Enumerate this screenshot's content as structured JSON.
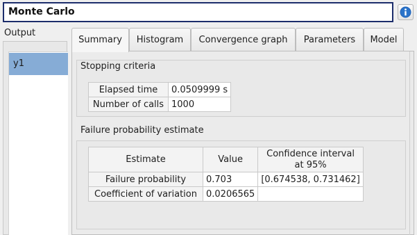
{
  "header": {
    "title": "Monte Carlo",
    "info_icon": "info-icon",
    "info_color": "#1f63b8"
  },
  "sidebar": {
    "label": "Output",
    "items": [
      {
        "label": "y1",
        "selected": true
      }
    ],
    "selected_color": "#86acd6"
  },
  "tabs": [
    {
      "label": "Summary",
      "active": true
    },
    {
      "label": "Histogram",
      "active": false
    },
    {
      "label": "Convergence graph",
      "active": false
    },
    {
      "label": "Parameters",
      "active": false
    },
    {
      "label": "Model",
      "active": false
    }
  ],
  "stopping": {
    "title": "Stopping criteria",
    "rows": [
      {
        "label": "Elapsed time",
        "value": "0.0509999 s"
      },
      {
        "label": "Number of calls",
        "value": "1000"
      }
    ]
  },
  "failure": {
    "title": "Failure probability estimate",
    "headers": {
      "estimate": "Estimate",
      "value": "Value",
      "ci_line1": "Confidence interval",
      "ci_line2": "at 95%"
    },
    "rows": [
      {
        "label": "Failure probability",
        "value": "0.703",
        "ci": "[0.674538, 0.731462]"
      },
      {
        "label": "Coefficient of variation",
        "value": "0.0206565",
        "ci": ""
      }
    ]
  }
}
